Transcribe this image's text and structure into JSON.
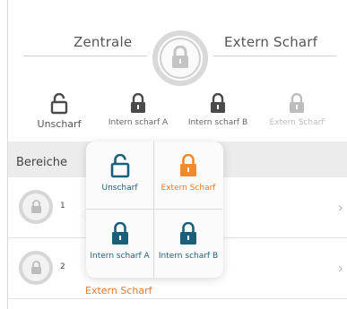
{
  "header": {
    "left_label": "Zentrale",
    "right_label": "Extern Scharf"
  },
  "modes": [
    {
      "label": "Unscharf",
      "icon": "unlocked-icon"
    },
    {
      "label": "Intern scharf A",
      "icon": "lock-icon"
    },
    {
      "label": "Intern scharf B",
      "icon": "lock-icon"
    },
    {
      "label": "Extern Scharf",
      "icon": "lock-icon"
    }
  ],
  "section": {
    "title": "Bereiche"
  },
  "areas": [
    {
      "number": "1",
      "state": ""
    },
    {
      "number": "2",
      "state": "Extern Scharf"
    }
  ],
  "popup": {
    "options": [
      {
        "label": "Unscharf",
        "color": "#1a5f7a"
      },
      {
        "label": "Extern Scharf",
        "color": "#f08a2c"
      },
      {
        "label": "Intern scharf A",
        "color": "#1a5f7a"
      },
      {
        "label": "Intern scharf B",
        "color": "#1a5f7a"
      }
    ]
  },
  "colors": {
    "accent_blue": "#1a5f7a",
    "accent_orange": "#f08a2c",
    "icon_dark": "#4a4a4a",
    "icon_disabled": "#bdbdbd"
  }
}
